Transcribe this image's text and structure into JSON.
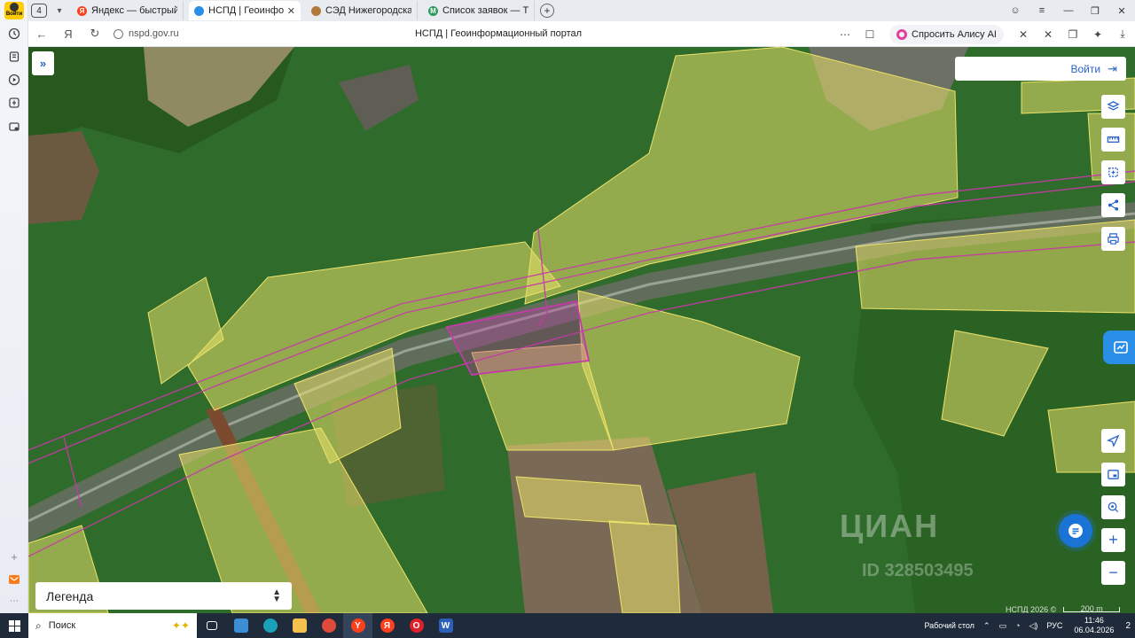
{
  "sidebar": {
    "avatar_label": "Войти"
  },
  "tabs": {
    "count": "4",
    "items": [
      {
        "label": "Яндекс — быстрый поиск",
        "color": "#fc3f1d"
      },
      {
        "label": "НСПД | Геоинформационный портал",
        "color": "#2a8ee6"
      },
      {
        "label": "СЭД Нижегородская область",
        "color": "#b07a3c"
      },
      {
        "label": "Список заявок — ТехноКад",
        "color": "#2b9a5a"
      }
    ]
  },
  "address": {
    "url": "nspd.gov.ru",
    "page_title": "НСПД | Геоинформационный портал",
    "alice_label": "Спросить Алису AI"
  },
  "map": {
    "login_label": "Войти",
    "legend_label": "Легенда",
    "copyright": "НСПД 2026 ©",
    "scale_label": "200 m",
    "watermark": "ЦИАН",
    "watermark_id": "ID 328503495",
    "colors": {
      "forest": "#2f6b2b",
      "parcel_fill": "#e8e06a",
      "selected_parcel": "#c43aa8",
      "accent": "#2a63c7"
    }
  },
  "taskbar": {
    "search_label": "Поиск",
    "desktop_label": "Рабочий стол",
    "lang": "РУС",
    "time": "11:46",
    "date": "06.04.2026",
    "notif_count": "2"
  }
}
